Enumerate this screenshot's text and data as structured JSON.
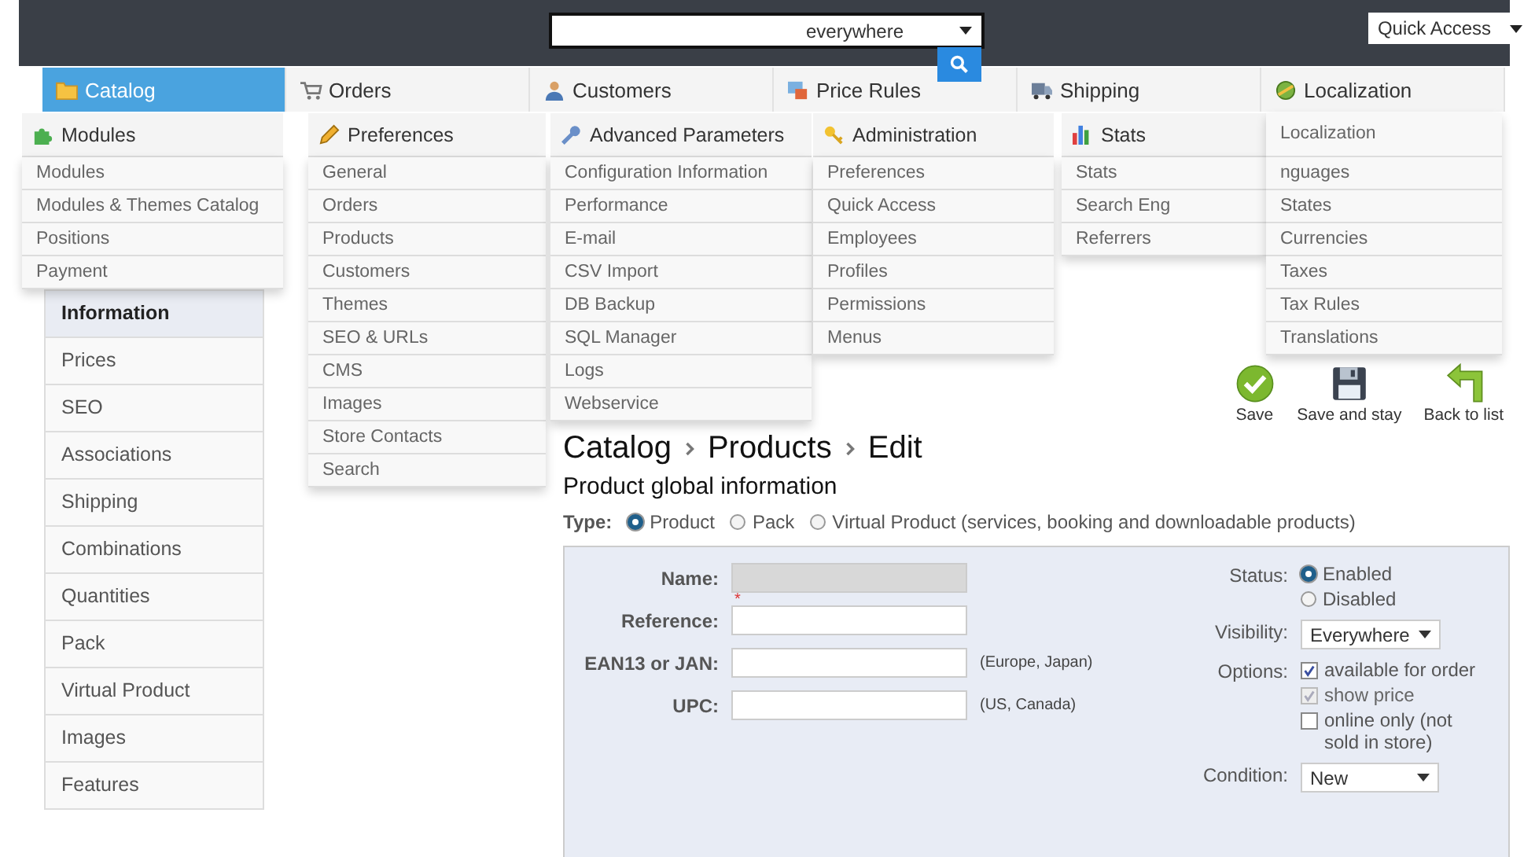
{
  "header": {
    "search_scope": "everywhere",
    "quick_access": "Quick Access"
  },
  "nav": {
    "tabs": [
      {
        "label": "Catalog",
        "selected": true
      },
      {
        "label": "Orders",
        "selected": false
      },
      {
        "label": "Customers",
        "selected": false
      },
      {
        "label": "Price Rules",
        "selected": false
      },
      {
        "label": "Shipping",
        "selected": false
      },
      {
        "label": "Localization",
        "selected": false
      }
    ]
  },
  "menus": [
    {
      "title": "Modules",
      "items": [
        "Modules",
        "Modules & Themes Catalog",
        "Positions",
        "Payment"
      ]
    },
    {
      "title": "Preferences",
      "items": [
        "General",
        "Orders",
        "Products",
        "Customers",
        "Themes",
        "SEO & URLs",
        "CMS",
        "Images",
        "Store Contacts",
        "Search"
      ]
    },
    {
      "title": "Advanced Parameters",
      "items": [
        "Configuration Information",
        "Performance",
        "E-mail",
        "CSV Import",
        "DB Backup",
        "SQL Manager",
        "Logs",
        "Webservice"
      ]
    },
    {
      "title": "Administration",
      "items": [
        "Preferences",
        "Quick Access",
        "Employees",
        "Profiles",
        "Permissions",
        "Menus"
      ]
    },
    {
      "title": "Stats",
      "items": [
        "Stats",
        "Search Eng",
        "Referrers"
      ]
    }
  ],
  "localization_menu": {
    "items": [
      "Localization",
      "nguages",
      "States",
      "Currencies",
      "Taxes",
      "Tax Rules",
      "Translations"
    ]
  },
  "toolbar": [
    {
      "label": "Save"
    },
    {
      "label": "Save and stay"
    },
    {
      "label": "Back to list"
    }
  ],
  "breadcrumb": [
    "Catalog",
    "Products",
    "Edit"
  ],
  "product_tabs": [
    {
      "label": "Information",
      "selected": true
    },
    {
      "label": "Prices",
      "selected": false
    },
    {
      "label": "SEO",
      "selected": false
    },
    {
      "label": "Associations",
      "selected": false
    },
    {
      "label": "Shipping",
      "selected": false
    },
    {
      "label": "Combinations",
      "selected": false
    },
    {
      "label": "Quantities",
      "selected": false
    },
    {
      "label": "Pack",
      "selected": false
    },
    {
      "label": "Virtual Product",
      "selected": false
    },
    {
      "label": "Images",
      "selected": false
    },
    {
      "label": "Features",
      "selected": false
    }
  ],
  "heading": "Product global information",
  "type": {
    "label": "Type:",
    "options": [
      {
        "label": "Product",
        "selected": true
      },
      {
        "label": "Pack",
        "selected": false
      },
      {
        "label": "Virtual Product (services, booking and downloadable products)",
        "selected": false
      }
    ]
  },
  "fields": [
    {
      "label": "Name:",
      "required_mark": "*",
      "disabled": true
    },
    {
      "label": "Reference:",
      "disabled": false
    },
    {
      "label": "EAN13 or JAN:",
      "hint": "(Europe, Japan)",
      "disabled": false
    },
    {
      "label": "UPC:",
      "hint": "(US, Canada)",
      "disabled": false
    }
  ],
  "status": {
    "label": "Status:",
    "options": [
      {
        "label": "Enabled",
        "selected": true
      },
      {
        "label": "Disabled",
        "selected": false
      }
    ]
  },
  "visibility": {
    "label": "Visibility:",
    "value": "Everywhere"
  },
  "options": {
    "label": "Options:",
    "items": [
      {
        "label": "available for order",
        "checked": true,
        "disabled": false
      },
      {
        "label": "show price",
        "checked": true,
        "disabled": true
      },
      {
        "label": "online only (not sold in store)",
        "checked": false,
        "disabled": false
      }
    ]
  },
  "condition": {
    "label": "Condition:",
    "value": "New"
  }
}
